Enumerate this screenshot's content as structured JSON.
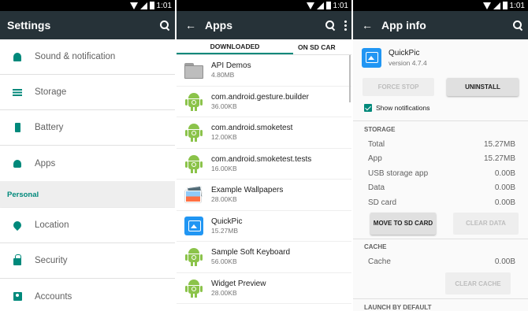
{
  "status": {
    "time": "1:01"
  },
  "settings": {
    "title": "Settings",
    "device_items": [
      {
        "label": "Sound & notification",
        "icon": "bell-icon"
      },
      {
        "label": "Storage",
        "icon": "storage-icon"
      },
      {
        "label": "Battery",
        "icon": "battery-icon"
      },
      {
        "label": "Apps",
        "icon": "android-icon"
      }
    ],
    "personal_header": "Personal",
    "personal_items": [
      {
        "label": "Location",
        "icon": "location-icon"
      },
      {
        "label": "Security",
        "icon": "lock-icon"
      },
      {
        "label": "Accounts",
        "icon": "account-icon"
      }
    ]
  },
  "apps": {
    "title": "Apps",
    "tabs": [
      "DOWNLOADED",
      "ON SD CAR"
    ],
    "list": [
      {
        "name": "API Demos",
        "size": "4.80MB",
        "icon": "folder-icon"
      },
      {
        "name": "com.android.gesture.builder",
        "size": "36.00KB",
        "icon": "android-icon"
      },
      {
        "name": "com.android.smoketest",
        "size": "12.00KB",
        "icon": "android-icon"
      },
      {
        "name": "com.android.smoketest.tests",
        "size": "16.00KB",
        "icon": "android-icon"
      },
      {
        "name": "Example Wallpapers",
        "size": "28.00KB",
        "icon": "wallpaper-icon"
      },
      {
        "name": "QuickPic",
        "size": "15.27MB",
        "icon": "quickpic-icon"
      },
      {
        "name": "Sample Soft Keyboard",
        "size": "56.00KB",
        "icon": "android-icon"
      },
      {
        "name": "Widget Preview",
        "size": "28.00KB",
        "icon": "android-icon"
      }
    ]
  },
  "app_info": {
    "title": "App info",
    "app_name": "QuickPic",
    "version": "version 4.7.4",
    "force_stop": "FORCE STOP",
    "uninstall": "UNINSTALL",
    "show_notifications": "Show notifications",
    "storage_header": "STORAGE",
    "storage_rows": [
      {
        "label": "Total",
        "value": "15.27MB"
      },
      {
        "label": "App",
        "value": "15.27MB"
      },
      {
        "label": "USB storage app",
        "value": "0.00B"
      },
      {
        "label": "Data",
        "value": "0.00B"
      },
      {
        "label": "SD card",
        "value": "0.00B"
      }
    ],
    "move_to_sd": "MOVE TO SD CARD",
    "clear_data": "CLEAR DATA",
    "cache_header": "CACHE",
    "cache_label": "Cache",
    "cache_value": "0.00B",
    "clear_cache": "CLEAR CACHE",
    "launch_header": "LAUNCH BY DEFAULT"
  }
}
